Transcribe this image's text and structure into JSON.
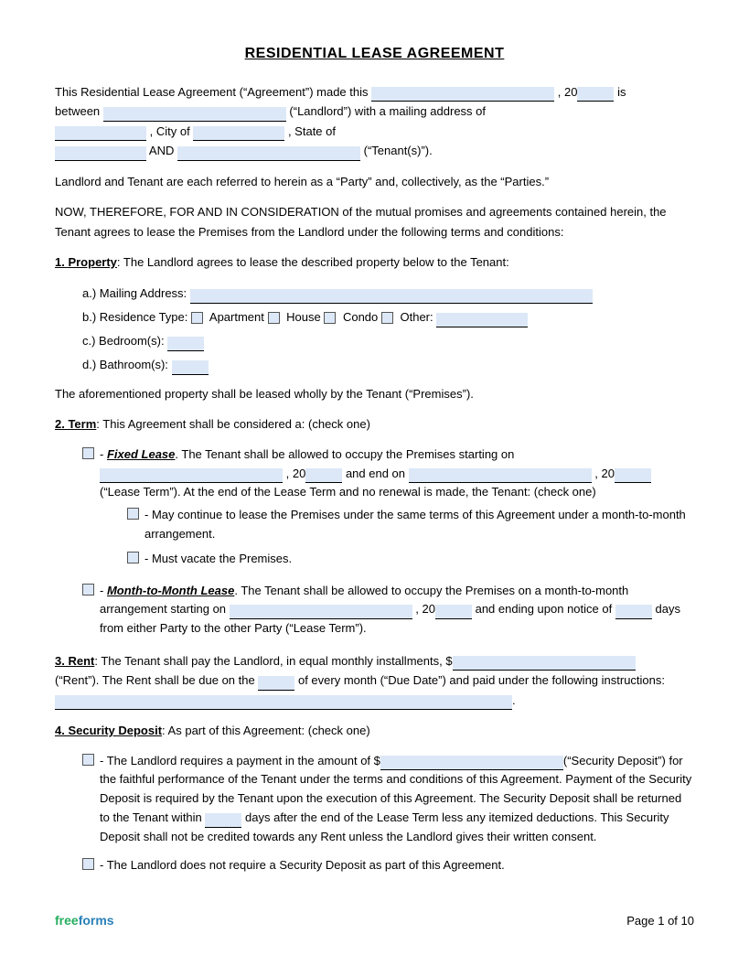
{
  "title": "RESIDENTIAL LEASE AGREEMENT",
  "intro": {
    "line1_pre": "This Residential Lease Agreement (“Agreement”) made this",
    "line1_mid": ", 20",
    "line1_post": "is",
    "line2_pre": "between",
    "line2_mid": "(“Landlord”) with a mailing address of",
    "line3_city_pre": ", City of",
    "line3_post": ", State of",
    "line4_and": "AND",
    "line4_post": "(“Tenant(s)”)."
  },
  "parties_note": "Landlord and Tenant are each referred to herein as a “Party” and, collectively, as the “Parties.”",
  "consideration": "NOW, THEREFORE, FOR AND IN CONSIDERATION of the mutual promises and agreements contained herein, the Tenant agrees to lease the Premises from the Landlord under the following terms and conditions:",
  "section1": {
    "heading": "1. Property",
    "text": ": The Landlord agrees to lease the described property below to the Tenant:",
    "items": [
      {
        "label": "a.)  Mailing Address:"
      },
      {
        "label": "b.)  Residence Type:",
        "options": [
          "Apartment",
          "House",
          "Condo",
          "Other:"
        ]
      },
      {
        "label": "c.)  Bedroom(s):"
      },
      {
        "label": "d.)  Bathroom(s):"
      }
    ],
    "footer": "The aforementioned property shall be leased wholly by the Tenant (“Premises”)."
  },
  "section2": {
    "heading": "2. Term",
    "text": ": This Agreement shall be considered a: (check one)",
    "fixed_lease": {
      "label": "- ",
      "underline_label": "Fixed Lease",
      "text1": ". The Tenant shall be allowed to occupy the Premises starting on",
      "text2": ", 20",
      "text3": "and end on",
      "text4": ", 20",
      "text5": "(“Lease Term”). At the end of the Lease Term and no renewal is made, the Tenant: (check one)",
      "sub1": "- May continue to lease the Premises under the same terms of this Agreement under a month-to-month arrangement.",
      "sub2": "- Must vacate the Premises."
    },
    "month_lease": {
      "label": "- ",
      "underline_label": "Month-to-Month Lease",
      "text1": ". The Tenant shall be allowed to occupy the Premises on a month-to-month arrangement starting on",
      "text2": ", 20",
      "text3": "and ending upon notice of",
      "text4": "days from either Party to the other Party (“Lease Term”)."
    }
  },
  "section3": {
    "heading": "3. Rent",
    "text1": ": The Tenant shall pay the Landlord, in equal monthly installments, $",
    "text2": "(“Rent”). The Rent shall be due on the",
    "text3": "of every month (“Due Date”) and paid under the following instructions:"
  },
  "section4": {
    "heading": "4. Security Deposit",
    "text": ": As part of this Agreement: (check one)",
    "option1": {
      "text1": "- The Landlord requires a payment in the amount of $",
      "text2": "(“Security Deposit”) for the faithful performance of the Tenant under the terms and conditions of this Agreement. Payment of the Security Deposit is required by the Tenant upon the execution of this Agreement. The Security Deposit shall be returned to the Tenant within",
      "text3": "days after the end of the Lease Term less any itemized deductions. This Security Deposit shall not be credited towards any Rent unless the Landlord gives their written consent."
    },
    "option2": "- The Landlord does not require a Security Deposit as part of this Agreement."
  },
  "footer": {
    "brand_free": "free",
    "brand_forms": "forms",
    "page": "Page 1 of 10"
  }
}
